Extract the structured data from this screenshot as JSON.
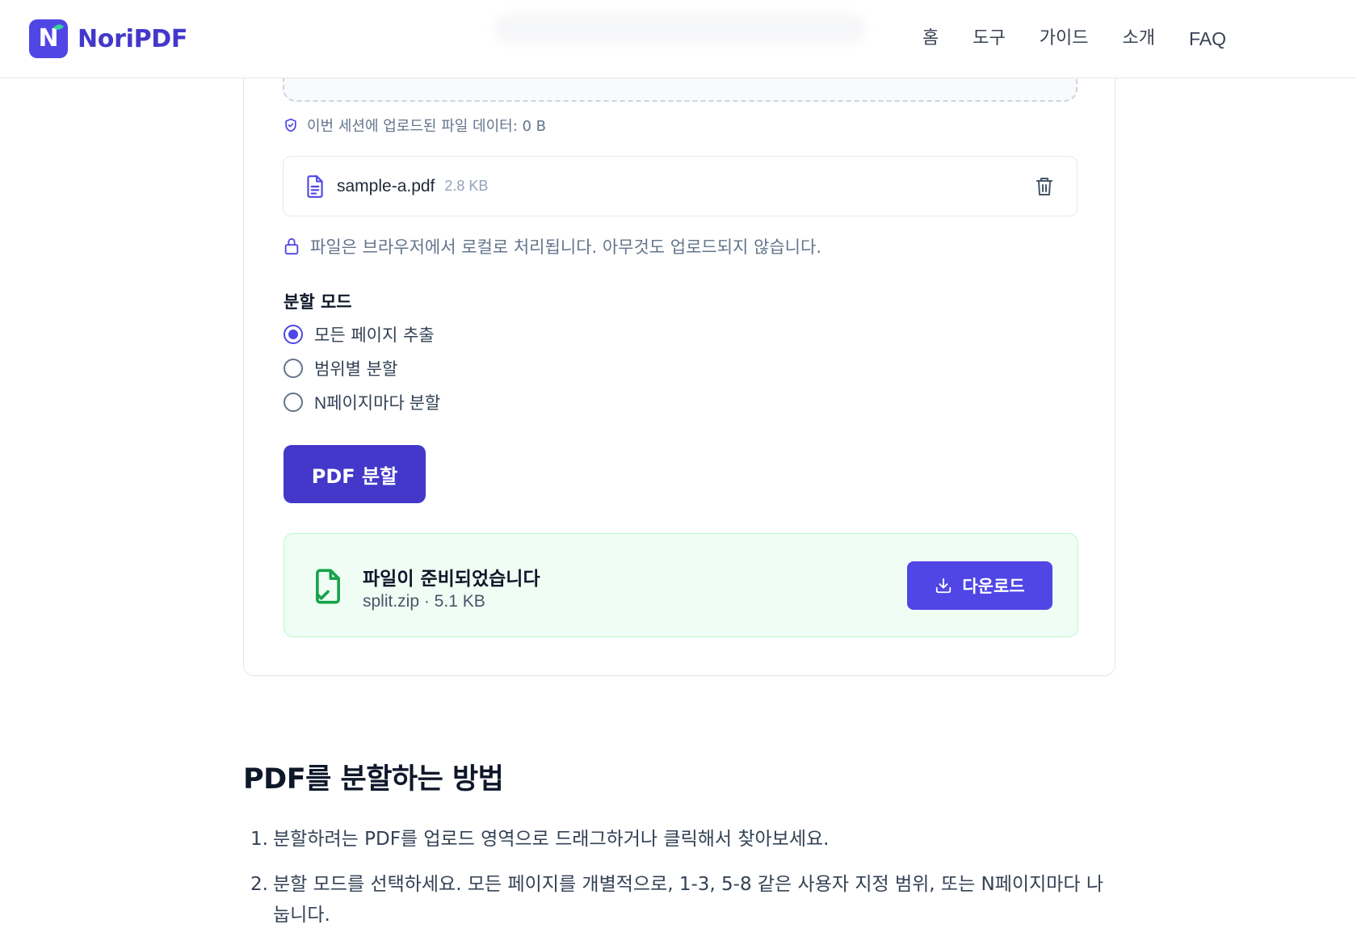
{
  "header": {
    "brand": "NoriPDF",
    "logo_letter": "N",
    "nav": [
      "홈",
      "도구",
      "가이드",
      "소개",
      "FAQ"
    ]
  },
  "upload": {
    "session_note": "이번 세션에 업로드된 파일 데이터: 0 B",
    "file": {
      "name": "sample-a.pdf",
      "size": "2.8 KB"
    },
    "local_note": "파일은 브라우저에서 로컬로 처리됩니다. 아무것도 업로드되지 않습니다."
  },
  "split_mode": {
    "label": "분할 모드",
    "options": [
      "모든 페이지 추출",
      "범위별 분할",
      "N페이지마다 분할"
    ],
    "selected": "모든 페이지 추출"
  },
  "split_button": "PDF 분할",
  "result": {
    "title": "파일이 준비되었습니다",
    "subtitle": "split.zip · 5.1 KB",
    "download_label": "다운로드"
  },
  "howto": {
    "title": "PDF를 분할하는 방법",
    "steps": [
      {
        "num": "1.",
        "text": "분할하려는 PDF를 업로드 영역으로 드래그하거나 클릭해서 찾아보세요."
      },
      {
        "num": "2.",
        "text": "분할 모드를 선택하세요. 모든 페이지를 개별적으로, 1-3, 5-8 같은 사용자 지정 범위, 또는 N페이지마다 나눕니다."
      }
    ]
  },
  "colors": {
    "brand": "#4f46e5",
    "brand_dark": "#4338ca",
    "success_bg": "#f0fdf4",
    "success_icon": "#16a34a"
  }
}
